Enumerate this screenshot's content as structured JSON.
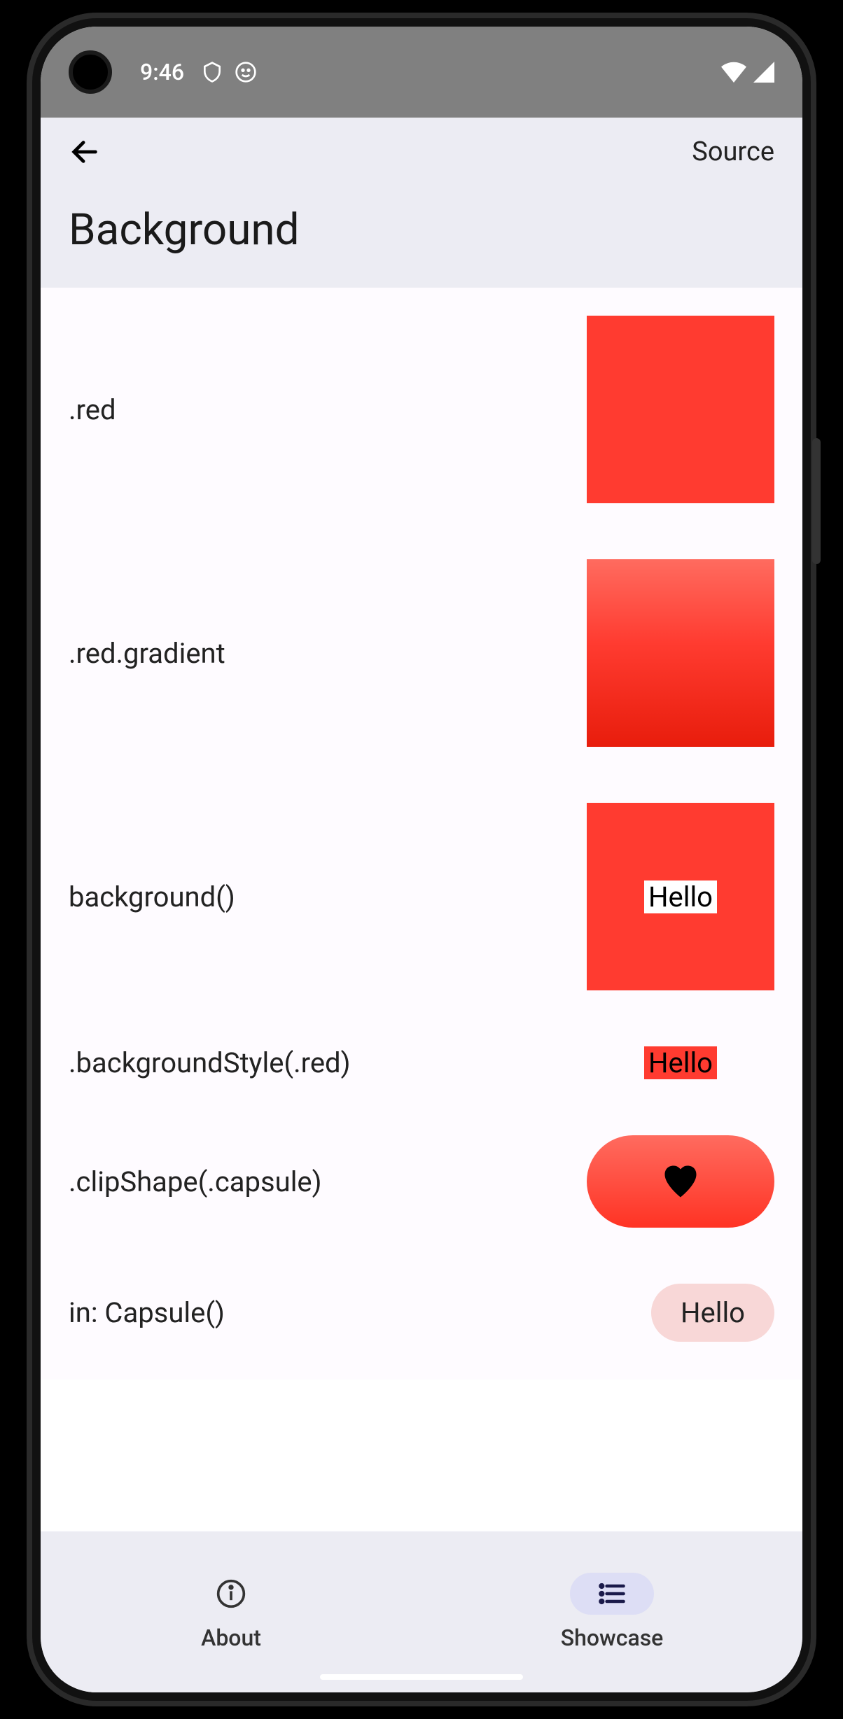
{
  "status": {
    "time": "9:46"
  },
  "header": {
    "source_label": "Source",
    "title": "Background"
  },
  "rows": {
    "red": ".red",
    "red_gradient": ".red.gradient",
    "background_fn": "background()",
    "background_style": ".backgroundStyle(.red)",
    "clip_shape": ".clipShape(.capsule)",
    "in_capsule": "in: Capsule()"
  },
  "labels": {
    "hello": "Hello"
  },
  "nav": {
    "about": "About",
    "showcase": "Showcase"
  }
}
